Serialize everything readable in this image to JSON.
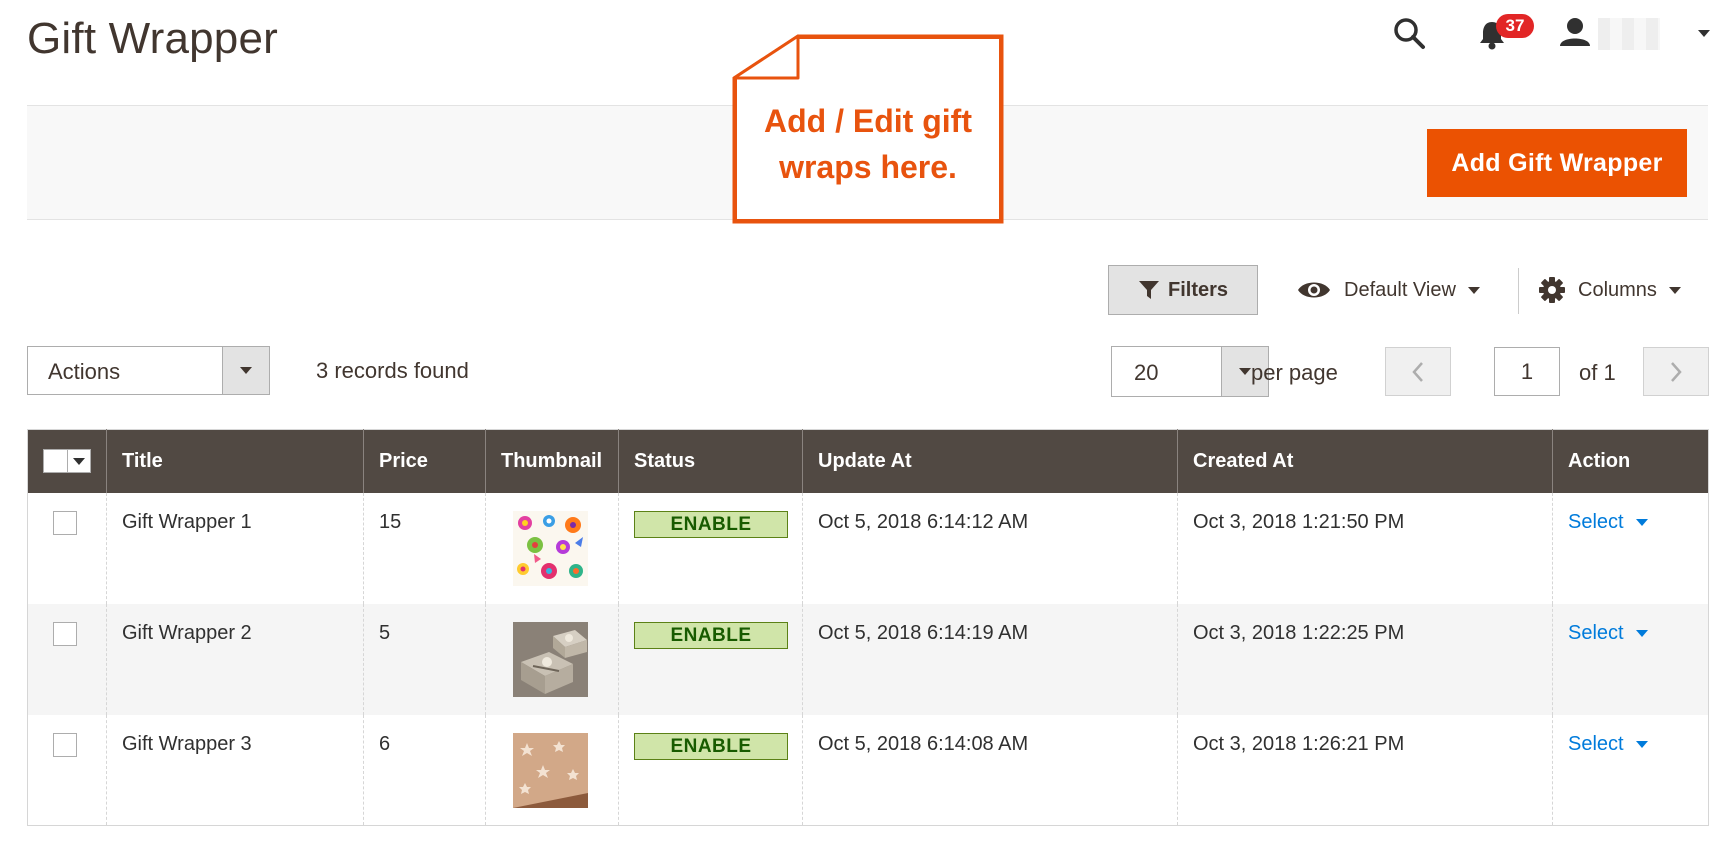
{
  "page": {
    "title": "Gift Wrapper"
  },
  "header": {
    "notifications_count": "37",
    "search_icon": "search-icon",
    "bell_icon": "bell-icon",
    "user_icon": "user-icon"
  },
  "callout": {
    "line1": "Add / Edit gift",
    "line2": "wraps here."
  },
  "page_actions": {
    "add_label": "Add Gift Wrapper"
  },
  "toolbar": {
    "filters_label": "Filters",
    "view_label": "Default View",
    "columns_label": "Columns"
  },
  "mass_actions": {
    "label": "Actions"
  },
  "records_found": "3 records found",
  "pagination": {
    "per_page_value": "20",
    "per_page_label": "per page",
    "current_page": "1",
    "of_label": "of 1"
  },
  "grid": {
    "columns": [
      "Title",
      "Price",
      "Thumbnail",
      "Status",
      "Update At",
      "Created At",
      "Action"
    ],
    "rows": [
      {
        "title": "Gift Wrapper 1",
        "price": "15",
        "thumbnail": "floral-butterfly-pattern",
        "status": "ENABLE",
        "updated": "Oct 5, 2018 6:14:12 AM",
        "created": "Oct 3, 2018 1:21:50 PM",
        "action": "Select"
      },
      {
        "title": "Gift Wrapper 2",
        "price": "5",
        "thumbnail": "silver-gift-boxes",
        "status": "ENABLE",
        "updated": "Oct 5, 2018 6:14:19 AM",
        "created": "Oct 3, 2018 1:22:25 PM",
        "action": "Select"
      },
      {
        "title": "Gift Wrapper 3",
        "price": "6",
        "thumbnail": "kraft-star-paper",
        "status": "ENABLE",
        "updated": "Oct 5, 2018 6:14:08 AM",
        "created": "Oct 3, 2018 1:26:21 PM",
        "action": "Select"
      }
    ]
  },
  "colors": {
    "accent": "#eb5202",
    "header_bg": "#514943",
    "status_bg": "#d0e5a9",
    "link": "#007bdb",
    "callout": "#e8530e"
  }
}
